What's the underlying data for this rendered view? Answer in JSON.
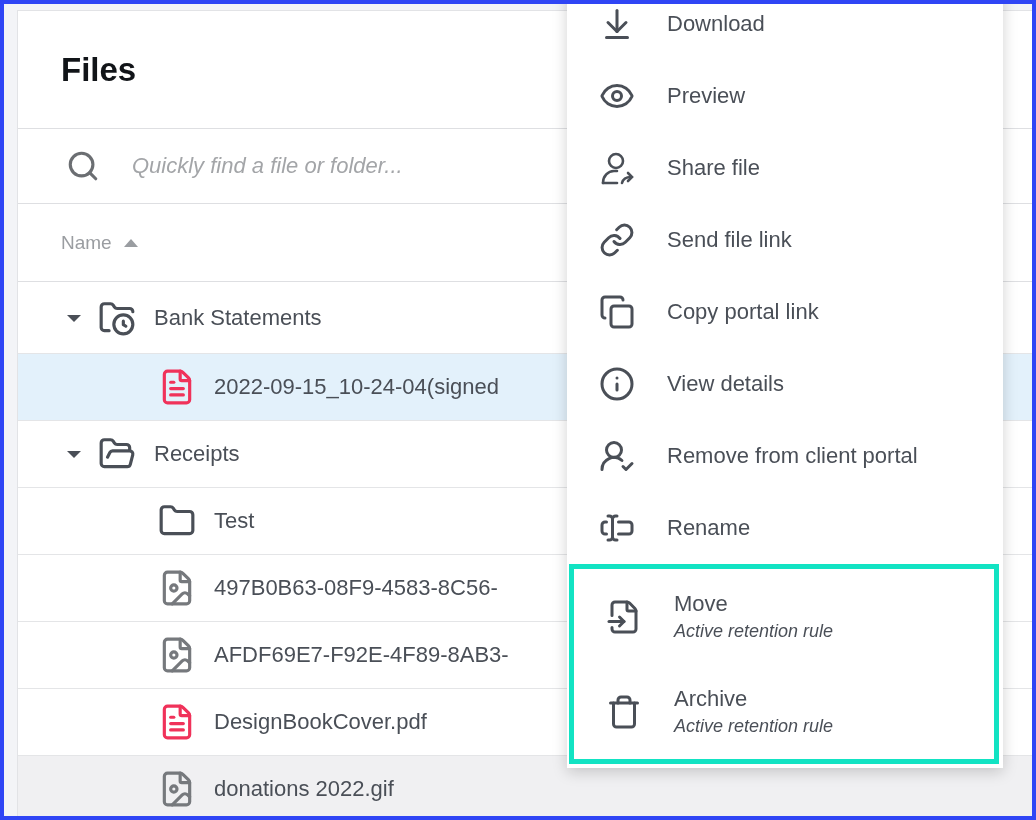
{
  "header": {
    "title": "Files"
  },
  "search": {
    "placeholder": "Quickly find a file or folder..."
  },
  "table": {
    "columns": [
      {
        "label": "Name",
        "sort_ascending": true
      }
    ],
    "rows": [
      {
        "kind": "folder-clock",
        "name": "Bank Statements",
        "expanded": true,
        "selected": false,
        "hovered": false,
        "children": [
          {
            "kind": "pdf",
            "name": "2022-09-15_10-24-04(signed",
            "selected": true,
            "hovered": false
          }
        ]
      },
      {
        "kind": "folder",
        "name": "Receipts",
        "expanded": true,
        "selected": false,
        "hovered": false,
        "children": [
          {
            "kind": "folder",
            "name": "Test",
            "expanded": false,
            "selected": false,
            "hovered": false
          },
          {
            "kind": "image",
            "name": "497B0B63-08F9-4583-8C56-",
            "selected": false,
            "hovered": false
          },
          {
            "kind": "image",
            "name": "AFDF69E7-F92E-4F89-8AB3-",
            "selected": false,
            "hovered": false
          },
          {
            "kind": "pdf",
            "name": "DesignBookCover.pdf",
            "selected": false,
            "hovered": false
          },
          {
            "kind": "image",
            "name": "donations 2022.gif",
            "selected": false,
            "hovered": true
          }
        ]
      }
    ]
  },
  "context_menu": {
    "items": [
      {
        "kind": "download",
        "label": "Download",
        "highlighted": false
      },
      {
        "kind": "preview",
        "label": "Preview",
        "highlighted": false
      },
      {
        "kind": "share",
        "label": "Share file",
        "highlighted": false
      },
      {
        "kind": "link",
        "label": "Send file link",
        "highlighted": false
      },
      {
        "kind": "copy",
        "label": "Copy portal link",
        "highlighted": false
      },
      {
        "kind": "info",
        "label": "View details",
        "highlighted": false
      },
      {
        "kind": "remove",
        "label": "Remove from client portal",
        "highlighted": false
      },
      {
        "kind": "rename",
        "label": "Rename",
        "highlighted": false
      },
      {
        "kind": "move",
        "label": "Move",
        "note": "Active retention rule",
        "highlighted": true
      },
      {
        "kind": "archive",
        "label": "Archive",
        "note": "Active retention rule",
        "highlighted": true
      }
    ]
  }
}
